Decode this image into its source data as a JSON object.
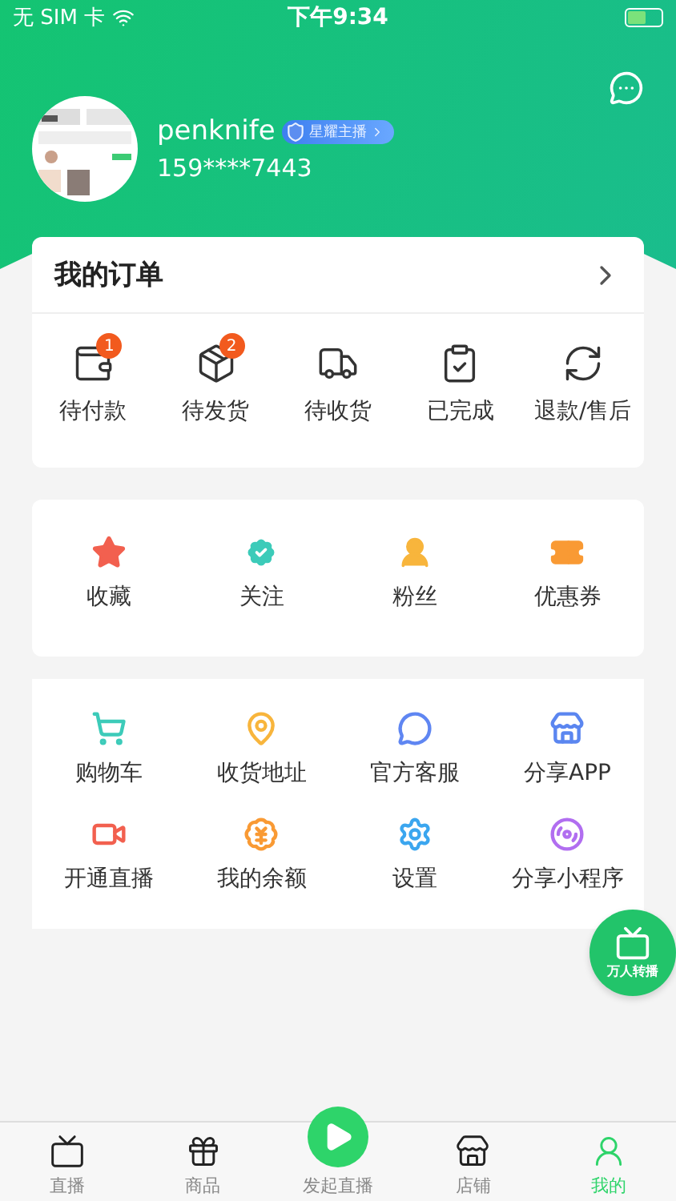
{
  "status_bar": {
    "carrier": "无 SIM 卡",
    "time": "下午9:34"
  },
  "profile": {
    "name": "penknife",
    "badge": "星耀主播",
    "phone": "159****7443"
  },
  "orders": {
    "title": "我的订单",
    "items": [
      {
        "label": "待付款",
        "count": "1"
      },
      {
        "label": "待发货",
        "count": "2"
      },
      {
        "label": "待收货"
      },
      {
        "label": "已完成"
      },
      {
        "label": "退款/售后"
      }
    ]
  },
  "shortcuts": [
    {
      "label": "收藏"
    },
    {
      "label": "关注"
    },
    {
      "label": "粉丝"
    },
    {
      "label": "优惠券"
    }
  ],
  "services": [
    {
      "label": "购物车"
    },
    {
      "label": "收货地址"
    },
    {
      "label": "官方客服"
    },
    {
      "label": "分享APP"
    },
    {
      "label": "开通直播"
    },
    {
      "label": "我的余额"
    },
    {
      "label": "设置"
    },
    {
      "label": "分享小程序"
    }
  ],
  "floating_button": {
    "label": "万人转播"
  },
  "tab_bar": [
    {
      "label": "直播",
      "selected": false
    },
    {
      "label": "商品",
      "selected": false
    },
    {
      "label": "发起直播",
      "selected": false,
      "kind": "center"
    },
    {
      "label": "店铺",
      "selected": false
    },
    {
      "label": "我的",
      "selected": true
    }
  ]
}
